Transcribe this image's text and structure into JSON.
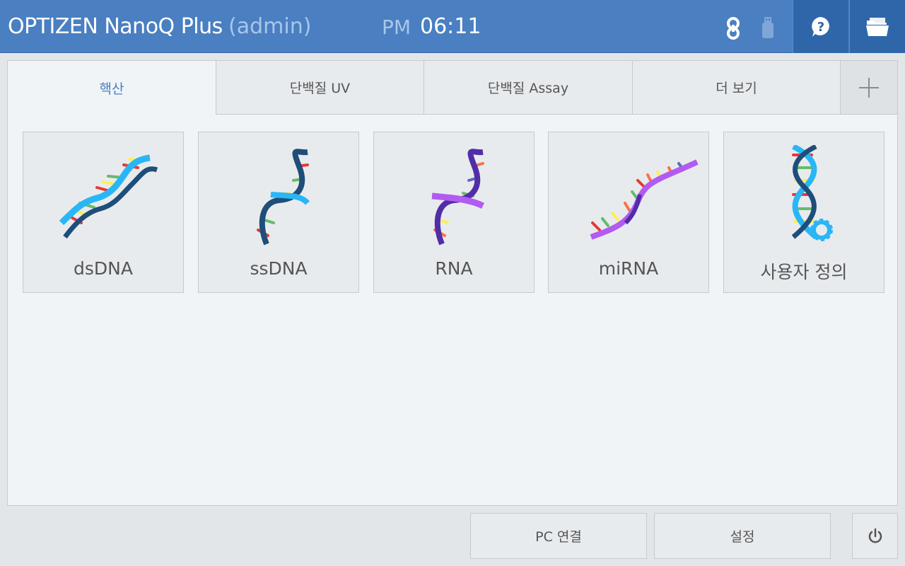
{
  "header": {
    "title": "OPTIZEN NanoQ Plus",
    "user": "(admin)",
    "ampm": "PM",
    "time": "06:11",
    "icons": [
      "link-icon",
      "usb-icon",
      "help-icon",
      "folder-icon"
    ],
    "colors": {
      "header_bg": "#4a7fc1",
      "button_bg": "#2f66aa",
      "accent_text": "#a9c6ea"
    }
  },
  "tabs": [
    {
      "label": "핵산",
      "active": true
    },
    {
      "label": "단백질 UV",
      "active": false
    },
    {
      "label": "단백질 Assay",
      "active": false
    },
    {
      "label": "더 보기",
      "active": false
    }
  ],
  "add_tab_icon": "plus-icon",
  "tiles": [
    {
      "label": "dsDNA",
      "icon": "dsdna-icon"
    },
    {
      "label": "ssDNA",
      "icon": "ssdna-icon"
    },
    {
      "label": "RNA",
      "icon": "rna-icon"
    },
    {
      "label": "miRNA",
      "icon": "mirna-icon"
    },
    {
      "label": "사용자 정의",
      "icon": "custom-dna-gear-icon"
    }
  ],
  "footer": {
    "pc_connect": "PC 연결",
    "settings": "설정",
    "power_icon": "power-icon"
  }
}
